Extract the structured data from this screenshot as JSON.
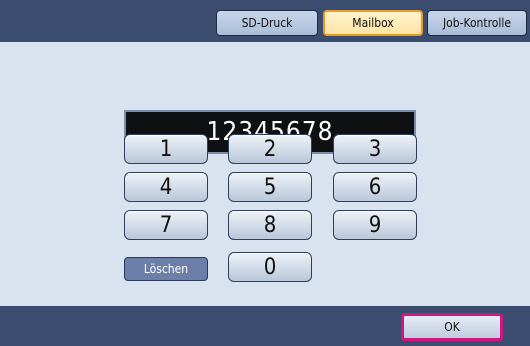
{
  "tabs": {
    "sd_print": "SD-Druck",
    "mailbox": "Mailbox",
    "job_control": "Job-Kontrolle"
  },
  "display": {
    "value": "12345678"
  },
  "keypad": {
    "k1": "1",
    "k2": "2",
    "k3": "3",
    "k4": "4",
    "k5": "5",
    "k6": "6",
    "k7": "7",
    "k8": "8",
    "k9": "9",
    "k0": "0",
    "clear": "Löschen"
  },
  "footer": {
    "ok": "OK"
  },
  "colors": {
    "accent_selected_tab": "#e79a2c",
    "ok_highlight": "#d1177f",
    "bar_navy": "#3b4d6f",
    "panel_bg": "#d9e3ef"
  }
}
